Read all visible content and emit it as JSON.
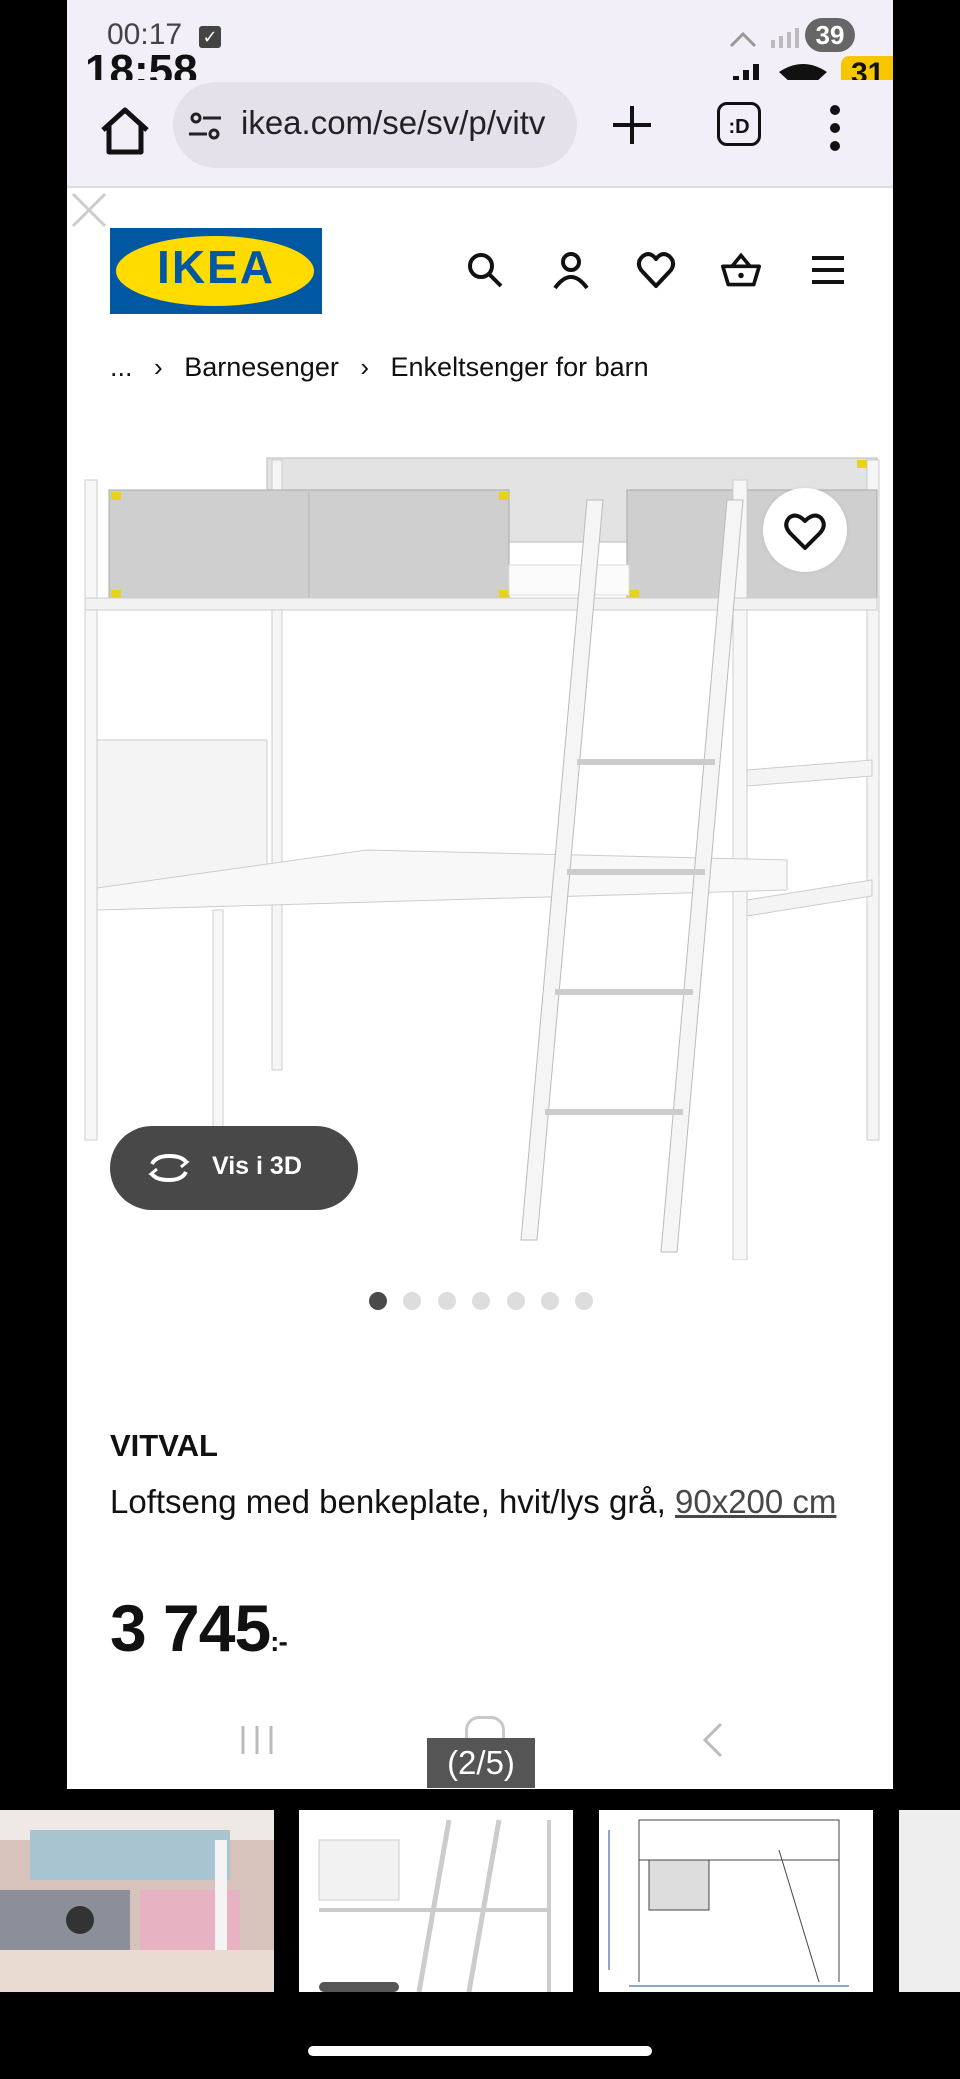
{
  "status_bar": {
    "time_small": "00:17",
    "time_big": "18:58",
    "badge_grey": "39",
    "badge_yellow": "31"
  },
  "browser": {
    "url": "ikea.com/se/sv/p/vitv",
    "tabs_label": ":D"
  },
  "header": {
    "logo_text": "IKEA",
    "brand_blue": "#0058a3",
    "brand_yellow": "#ffdb00",
    "icons": [
      "search-icon",
      "account-icon",
      "heart-icon",
      "basket-icon",
      "menu-icon"
    ]
  },
  "breadcrumb": {
    "ellipsis": "...",
    "items": [
      "Barnesenger",
      "Enkeltsenger for barn"
    ]
  },
  "gallery": {
    "vis3d_label": "Vis i 3D",
    "dot_count": 7,
    "active_dot": 0,
    "counter": "(2/5)"
  },
  "product": {
    "name": "VITVAL",
    "description": "Loftseng med benkeplate, hvit/lys grå, ",
    "size": "90x200 cm",
    "price": "3 745",
    "currency": ":-"
  }
}
